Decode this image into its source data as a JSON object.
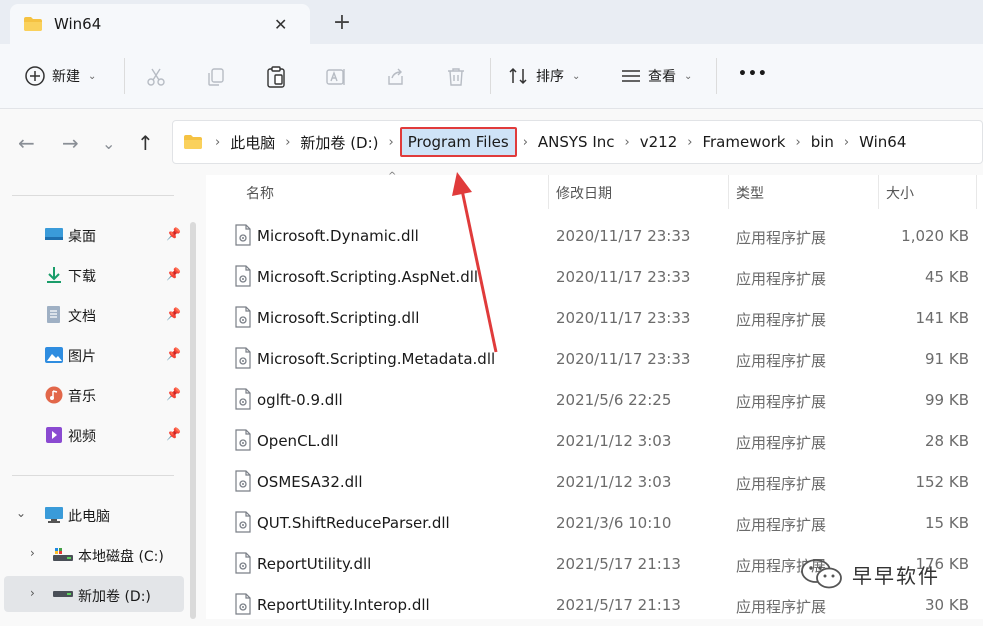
{
  "tab": {
    "title": "Win64",
    "close_glyph": "✕",
    "new_tab_glyph": "+"
  },
  "toolbar": {
    "new_label": "新建",
    "sort_label": "排序",
    "view_label": "查看",
    "more_glyph": "•••"
  },
  "breadcrumb": [
    "此电脑",
    "新加卷 (D:)",
    "Program Files",
    "ANSYS Inc",
    "v212",
    "Framework",
    "bin",
    "Win64"
  ],
  "sidebar": {
    "quick": [
      {
        "label": "桌面",
        "icon": "desktop-icon",
        "color": "#3a9bd9"
      },
      {
        "label": "下载",
        "icon": "download-icon",
        "color": "#1a9d6a"
      },
      {
        "label": "文档",
        "icon": "document-icon",
        "color": "#7d8fa6"
      },
      {
        "label": "图片",
        "icon": "pictures-icon",
        "color": "#2f8de0"
      },
      {
        "label": "音乐",
        "icon": "music-icon",
        "color": "#e2674a"
      },
      {
        "label": "视频",
        "icon": "video-icon",
        "color": "#8a4ad1"
      }
    ],
    "tree": [
      {
        "label": "此电脑",
        "icon": "pc-icon"
      },
      {
        "label": "本地磁盘 (C:)",
        "icon": "drive-c-icon"
      },
      {
        "label": "新加卷 (D:)",
        "icon": "drive-d-icon"
      }
    ]
  },
  "columns": {
    "name": "名称",
    "date": "修改日期",
    "type": "类型",
    "size": "大小"
  },
  "files": [
    {
      "name": "Microsoft.Dynamic.dll",
      "date": "2020/11/17 23:33",
      "type": "应用程序扩展",
      "size": "1,020 KB"
    },
    {
      "name": "Microsoft.Scripting.AspNet.dll",
      "date": "2020/11/17 23:33",
      "type": "应用程序扩展",
      "size": "45 KB"
    },
    {
      "name": "Microsoft.Scripting.dll",
      "date": "2020/11/17 23:33",
      "type": "应用程序扩展",
      "size": "141 KB"
    },
    {
      "name": "Microsoft.Scripting.Metadata.dll",
      "date": "2020/11/17 23:33",
      "type": "应用程序扩展",
      "size": "91 KB"
    },
    {
      "name": "oglft-0.9.dll",
      "date": "2021/5/6 22:25",
      "type": "应用程序扩展",
      "size": "99 KB"
    },
    {
      "name": "OpenCL.dll",
      "date": "2021/1/12 3:03",
      "type": "应用程序扩展",
      "size": "28 KB"
    },
    {
      "name": "OSMESA32.dll",
      "date": "2021/1/12 3:03",
      "type": "应用程序扩展",
      "size": "152 KB"
    },
    {
      "name": "QUT.ShiftReduceParser.dll",
      "date": "2021/3/6 10:10",
      "type": "应用程序扩展",
      "size": "15 KB"
    },
    {
      "name": "ReportUtility.dll",
      "date": "2021/5/17 21:13",
      "type": "应用程序扩展",
      "size": "176 KB"
    },
    {
      "name": "ReportUtility.Interop.dll",
      "date": "2021/5/17 21:13",
      "type": "应用程序扩展",
      "size": "30 KB"
    }
  ],
  "watermark": {
    "text": "早早软件"
  },
  "colors": {
    "highlight_border": "#e03b3b",
    "arrow": "#e03b3b",
    "selection": "#cfe3f7"
  }
}
